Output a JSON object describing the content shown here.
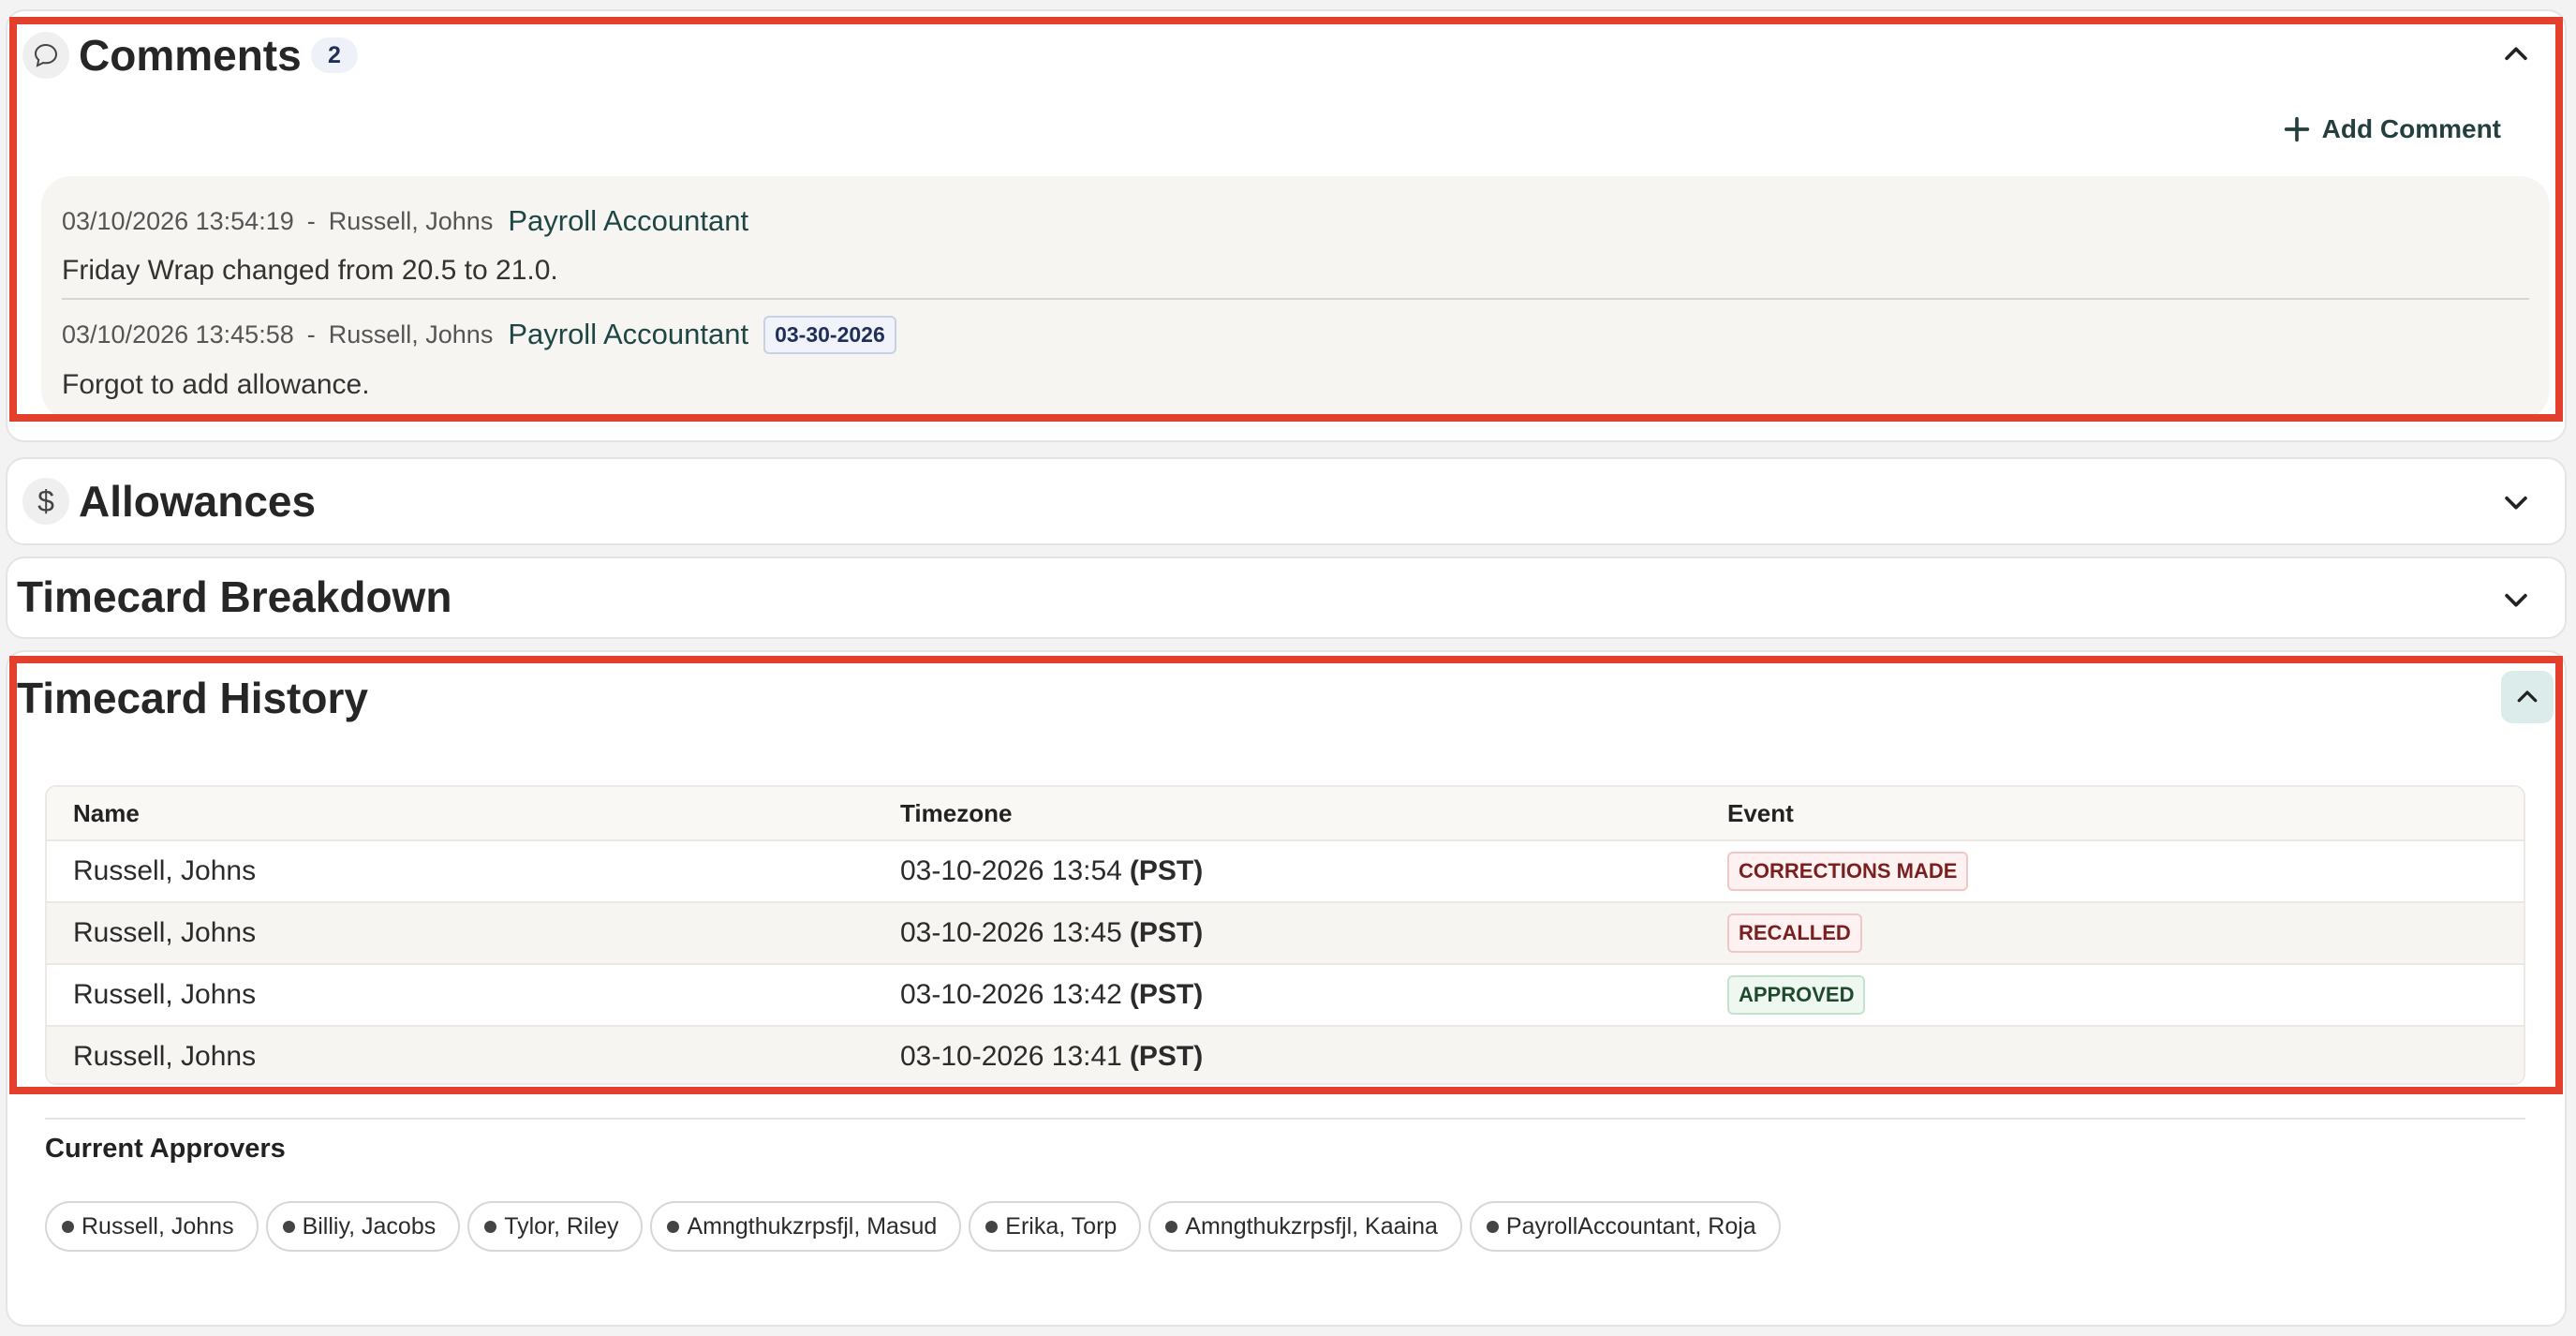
{
  "comments": {
    "title": "Comments",
    "count": "2",
    "add_label": "Add Comment",
    "items": [
      {
        "timestamp": "03/10/2026 13:54:19",
        "separator": "-",
        "author": "Russell, Johns",
        "role": "Payroll Accountant",
        "date_tag": "",
        "text": "Friday Wrap changed from 20.5 to 21.0."
      },
      {
        "timestamp": "03/10/2026 13:45:58",
        "separator": "-",
        "author": "Russell, Johns",
        "role": "Payroll Accountant",
        "date_tag": "03-30-2026",
        "text": "Forgot to add allowance."
      }
    ]
  },
  "allowances": {
    "title": "Allowances",
    "icon": "dollar-icon"
  },
  "breakdown": {
    "title": "Timecard Breakdown"
  },
  "history": {
    "title": "Timecard History",
    "columns": [
      "Name",
      "Timezone",
      "Event"
    ],
    "rows": [
      {
        "name": "Russell, Johns",
        "time": "03-10-2026 13:54",
        "zone": "(PST)",
        "event": "CORRECTIONS MADE",
        "event_color": "#7a1f1f",
        "event_bg": "#fdf1f1",
        "event_border": "#f0c7c7"
      },
      {
        "name": "Russell, Johns",
        "time": "03-10-2026 13:45",
        "zone": "(PST)",
        "event": "RECALLED",
        "event_color": "#7a1f1f",
        "event_bg": "#fdf1f1",
        "event_border": "#f0c7c7"
      },
      {
        "name": "Russell, Johns",
        "time": "03-10-2026 13:42",
        "zone": "(PST)",
        "event": "APPROVED",
        "event_color": "#1f4a2d",
        "event_bg": "#eef8f1",
        "event_border": "#c4e3cf"
      },
      {
        "name": "Russell, Johns",
        "time": "03-10-2026 13:41",
        "zone": "(PST)",
        "event": "",
        "event_color": "",
        "event_bg": "",
        "event_border": ""
      }
    ]
  },
  "approvers": {
    "title": "Current Approvers",
    "people": [
      "Russell, Johns",
      "Billiy, Jacobs",
      "Tylor, Riley",
      "Amngthukzrpsfjl, Masud",
      "Erika, Torp",
      "Amngthukzrpsfjl, Kaaina",
      "PayrollAccountant, Roja"
    ]
  },
  "colors": {
    "highlight": "#e23f2c",
    "accent_teal": "#1f4646",
    "comment_bg": "#f7f5f1"
  }
}
